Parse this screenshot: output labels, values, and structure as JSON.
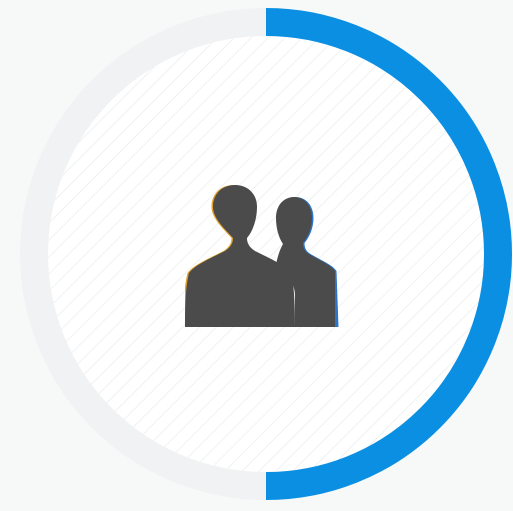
{
  "progress_ring": {
    "progress_fraction": 0.5,
    "progress_color": "#0a8fe3",
    "track_color": "#f1f2f3",
    "inner_fill_color": "#ffffff",
    "hatch_color": "#e6e8ea"
  },
  "center_icon": {
    "name": "users-icon",
    "color": "#4b4b4b",
    "accent_left_color": "#e3a12a",
    "accent_right_color": "#2a74c9"
  }
}
